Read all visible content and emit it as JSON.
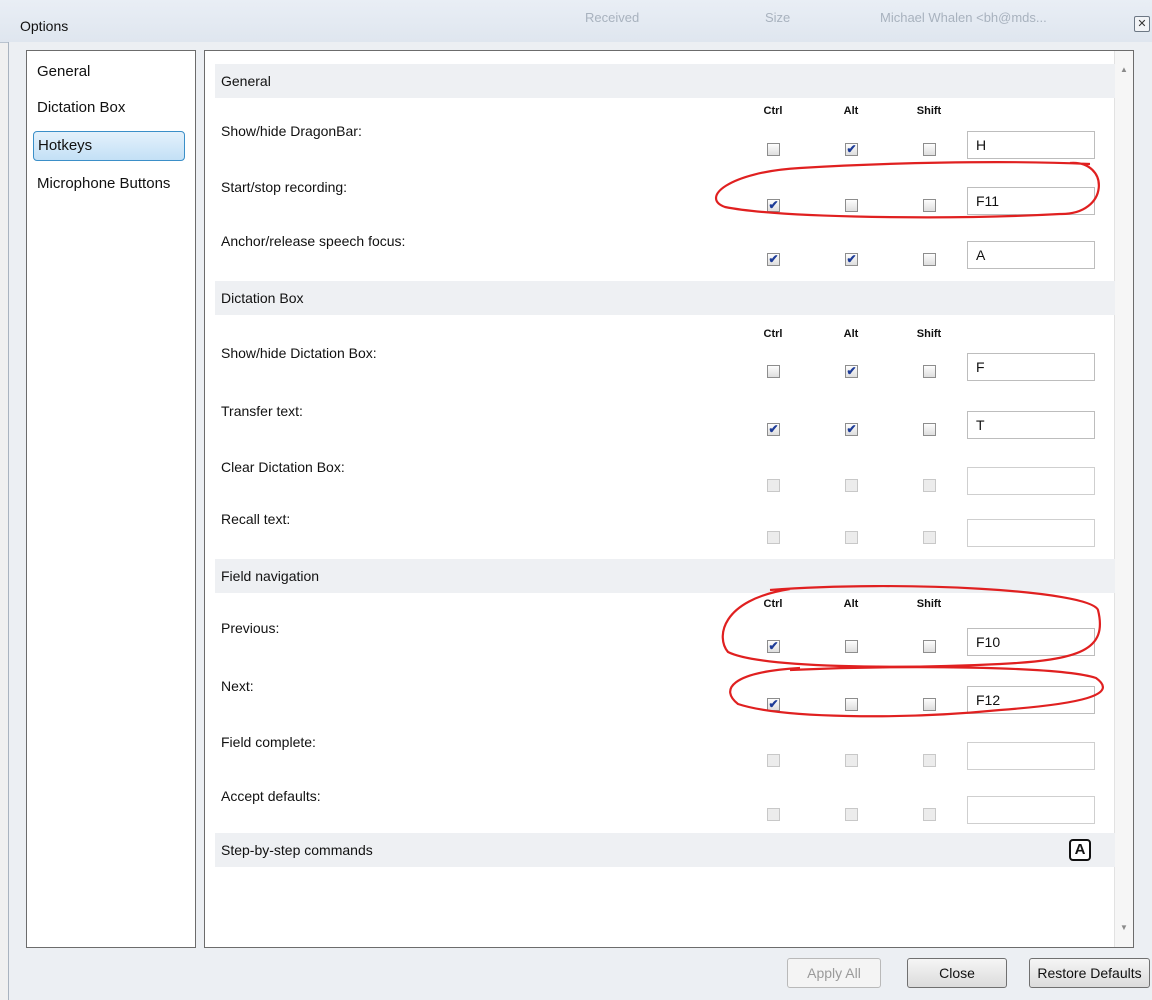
{
  "window": {
    "title": "Options",
    "close_glyph": "✕",
    "background_ghost": [
      "Received",
      "Size",
      "Michael Whalen <bh@mds..."
    ]
  },
  "sidebar": {
    "items": [
      {
        "label": "General",
        "selected": false
      },
      {
        "label": "Dictation Box",
        "selected": false
      },
      {
        "label": "Hotkeys",
        "selected": true
      },
      {
        "label": "Microphone Buttons",
        "selected": false
      }
    ]
  },
  "columns": {
    "ctrl": "Ctrl",
    "alt": "Alt",
    "shift": "Shift"
  },
  "sections": [
    {
      "title": "General",
      "rows": [
        {
          "label": "Show/hide DragonBar:",
          "ctrl": false,
          "alt": true,
          "shift": false,
          "key": "H",
          "enabled": true
        },
        {
          "label": "Start/stop recording:",
          "ctrl": true,
          "alt": false,
          "shift": false,
          "key": "F11",
          "enabled": true
        },
        {
          "label": "Anchor/release speech focus:",
          "ctrl": true,
          "alt": true,
          "shift": false,
          "key": "A",
          "enabled": true
        }
      ]
    },
    {
      "title": "Dictation Box",
      "rows": [
        {
          "label": "Show/hide Dictation Box:",
          "ctrl": false,
          "alt": true,
          "shift": false,
          "key": "F",
          "enabled": true
        },
        {
          "label": "Transfer text:",
          "ctrl": true,
          "alt": true,
          "shift": false,
          "key": "T",
          "enabled": true
        },
        {
          "label": "Clear Dictation Box:",
          "ctrl": false,
          "alt": false,
          "shift": false,
          "key": "",
          "enabled": false
        },
        {
          "label": "Recall text:",
          "ctrl": false,
          "alt": false,
          "shift": false,
          "key": "",
          "enabled": false
        }
      ]
    },
    {
      "title": "Field navigation",
      "rows": [
        {
          "label": "Previous:",
          "ctrl": true,
          "alt": false,
          "shift": false,
          "key": "F10",
          "enabled": true
        },
        {
          "label": "Next:",
          "ctrl": true,
          "alt": false,
          "shift": false,
          "key": "F12",
          "enabled": true
        },
        {
          "label": "Field complete:",
          "ctrl": false,
          "alt": false,
          "shift": false,
          "key": "",
          "enabled": false
        },
        {
          "label": "Accept defaults:",
          "ctrl": false,
          "alt": false,
          "shift": false,
          "key": "",
          "enabled": false
        }
      ]
    },
    {
      "title": "Step-by-step commands",
      "rows": []
    }
  ],
  "help_icon": {
    "name": "accessibility-a-icon",
    "glyph": "A"
  },
  "check_glyph": "✔",
  "buttons": {
    "apply_all": "Apply All",
    "close": "Close",
    "restore_defaults": "Restore Defaults"
  },
  "annotation_color": "#e02020"
}
